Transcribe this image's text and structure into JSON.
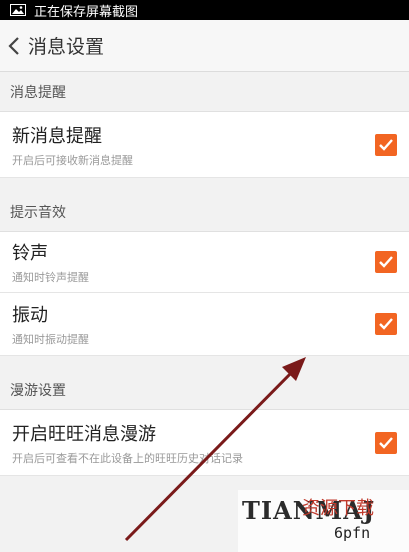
{
  "status_bar": {
    "text": "正在保存屏幕截图",
    "icon": "image-icon"
  },
  "header": {
    "title": "消息设置",
    "back_icon": "chevron-left-icon"
  },
  "sections": [
    {
      "title": "消息提醒",
      "items": [
        {
          "label": "新消息提醒",
          "desc": "开启后可接收新消息提醒",
          "checked": true
        }
      ]
    },
    {
      "title": "提示音效",
      "items": [
        {
          "label": "铃声",
          "desc": "通知时铃声提醒",
          "checked": true
        },
        {
          "label": "振动",
          "desc": "通知时振动提醒",
          "checked": true
        }
      ]
    },
    {
      "title": "漫游设置",
      "items": [
        {
          "label": "开启旺旺消息漫游",
          "desc": "开启后可查看不在此设备上的旺旺历史对话记录",
          "checked": true
        }
      ]
    }
  ],
  "colors": {
    "accent": "#f26522",
    "arrow": "#7a1a1a"
  },
  "watermark": {
    "main": "TIANMAJ",
    "cn": "资源下载",
    "url": "6pfn"
  }
}
